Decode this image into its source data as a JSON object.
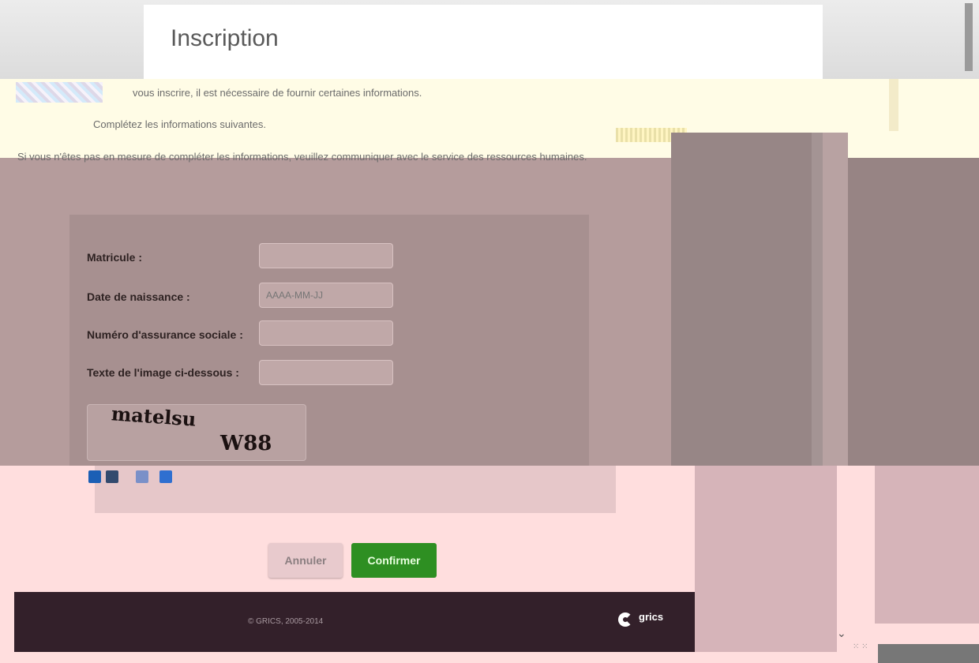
{
  "page": {
    "title": "Inscription"
  },
  "intro": {
    "line1": "vous inscrire, il est nécessaire de fournir certaines informations.",
    "line2": "Complétez les informations suivantes.",
    "more_glyph": "»",
    "contact": "Si vous n'êtes pas en mesure de compléter les informations, veuillez communiquer avec le service des ressources humaines."
  },
  "form": {
    "matricule_label": "Matricule :",
    "matricule_value": "",
    "birth_label": "Date de naissance :",
    "birth_placeholder": "AAAA-MM-JJ",
    "sin_label": "Numéro d'assurance sociale :",
    "sin_value": "",
    "captcha_label": "Texte de l'image ci-dessous :",
    "captcha_value": "",
    "captcha_word1": "matelsu",
    "captcha_word2": "W88"
  },
  "captcha_tools": [
    {
      "icon": "refresh-icon",
      "color": "#1b5fb5"
    },
    {
      "icon": "audio-icon",
      "color": "#324a6e"
    },
    {
      "icon": "info-icon",
      "color": "#7a90c8"
    },
    {
      "icon": "help-icon",
      "color": "#2f6fd0"
    }
  ],
  "buttons": {
    "cancel_label": "Annuler",
    "confirm_label": "Confirmer"
  },
  "footer": {
    "copyright": "© GRICS, 2005-2014",
    "brand": "grics"
  },
  "colors": {
    "accent": "#2e8f22",
    "footer_bg": "#33202a",
    "form_bg": "#a79090"
  },
  "chevron": "⌄"
}
